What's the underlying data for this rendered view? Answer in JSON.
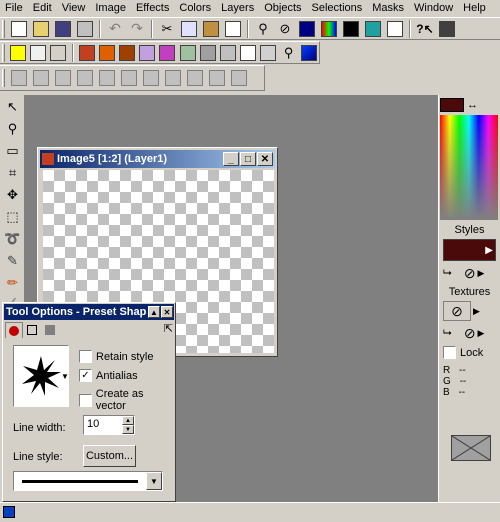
{
  "menu": [
    "File",
    "Edit",
    "View",
    "Image",
    "Effects",
    "Colors",
    "Layers",
    "Objects",
    "Selections",
    "Masks",
    "Window",
    "Help"
  ],
  "image_window": {
    "title": "Image5 [1:2] (Layer1)"
  },
  "tool_options": {
    "title": "Tool Options - Preset Shap",
    "retain_style": "Retain style",
    "antialias": "Antialias",
    "create_as_vector": "Create as vector",
    "line_width_label": "Line width:",
    "line_width_value": "10",
    "line_style_label": "Line style:",
    "custom_button": "Custom..."
  },
  "right_panel": {
    "styles_label": "Styles",
    "textures_label": "Textures",
    "lock_label": "Lock",
    "r_label": "R",
    "g_label": "G",
    "b_label": "B",
    "r_value": "--",
    "g_value": "--",
    "b_value": "--",
    "foreground_color": "#4a0a0a"
  }
}
